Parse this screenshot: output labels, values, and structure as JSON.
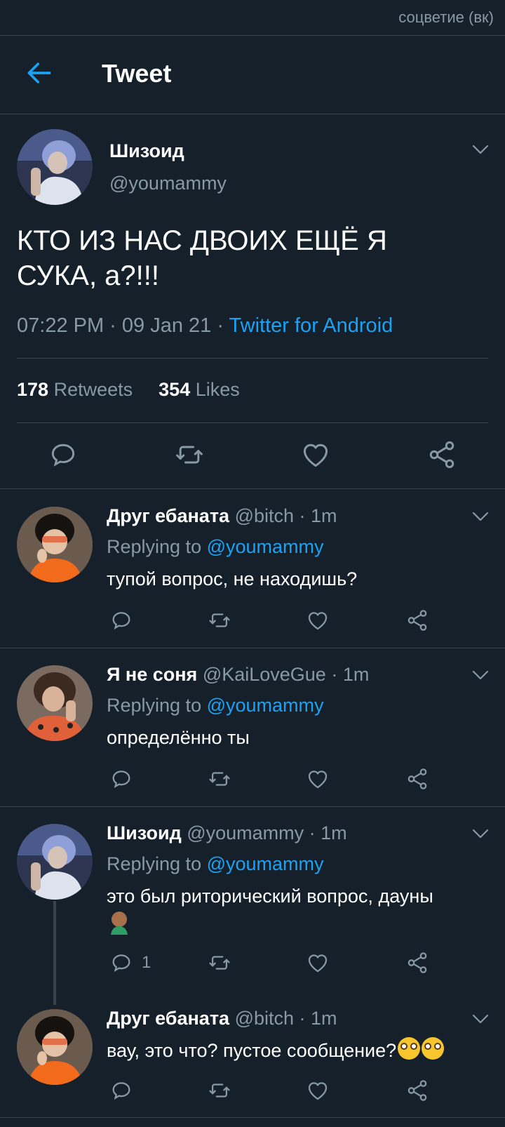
{
  "watermark": "соцветие (вк)",
  "header": {
    "title": "Tweet"
  },
  "tweet": {
    "name": "Шизоид",
    "handle": "@youmammy",
    "text": "КТО ИЗ НАС ДВОИХ ЕЩЁ Я СУКА, а?!!!",
    "time": "07:22 PM · 09 Jan 21 · ",
    "source": "Twitter for Android",
    "retweets": "178",
    "retweets_label": " Retweets",
    "likes": "354",
    "likes_label": " Likes"
  },
  "replies": [
    {
      "name": "Друг ебаната",
      "meta": " @bitch · 1m",
      "replying": "Replying to ",
      "to": "@youmammy",
      "text": "тупой вопрос, не находишь?",
      "reply_count": ""
    },
    {
      "name": "Я не соня",
      "meta": " @KaiLoveGue · 1m",
      "replying": "Replying to ",
      "to": "@youmammy",
      "text": "определённо ты",
      "reply_count": ""
    },
    {
      "name": "Шизоид",
      "meta": " @youmammy · 1m",
      "replying": "Replying to ",
      "to": "@youmammy",
      "text": "это был риторический вопрос, дауны",
      "reply_count": "1"
    },
    {
      "name": "Друг ебаната",
      "meta": " @bitch · 1m",
      "replying": "",
      "to": "",
      "text": "вау, это что? пустое сообщение?",
      "reply_count": ""
    }
  ],
  "colors": {
    "background": "#15202b",
    "border": "#38444d",
    "muted": "#8899a6",
    "accent": "#1da1f2"
  },
  "icons": [
    "back-arrow-icon",
    "chevron-down-icon",
    "reply-icon",
    "retweet-icon",
    "like-icon",
    "share-icon",
    "facepalm-emoji",
    "flushed-emoji"
  ]
}
